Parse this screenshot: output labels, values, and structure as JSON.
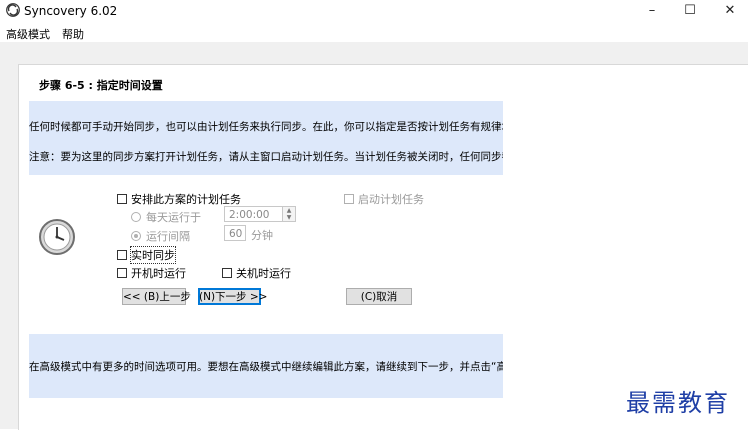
{
  "window": {
    "title": "Syncovery 6.02",
    "minimize": "–",
    "maximize": "☐",
    "close": "✕"
  },
  "menu": [
    "高级模式",
    "帮助"
  ],
  "step_title": "步骤 6-5 : 指定时间设置",
  "info_top": [
    "任何时候都可手动开始同步，也可以由计划任务来执行同步。在此，你可以指定是否按计划任务有规律地执行同步。",
    "注意：要为这里的同步方案打开计划任务，请从主窗口启动计划任务。当计划任务被关闭时，任何同步都不会自动执行。"
  ],
  "options": {
    "schedule_label": "安排此方案的计划任务",
    "start_scheduler_label": "启动计划任务",
    "daily_label": "每天运行于",
    "daily_time": "2:00:00",
    "interval_label": "运行间隔",
    "interval_value": "60",
    "interval_unit": "分钟",
    "realtime_label": "实时同步",
    "on_startup_label": "开机时运行",
    "on_shutdown_label": "关机时运行"
  },
  "buttons": {
    "back": "<< (B)上一步",
    "next": "(N)下一步 >>",
    "cancel": "(C)取消"
  },
  "info_bottom": "在高级模式中有更多的时间选项可用。要想在高级模式中继续编辑此方案，请继续到下一步，并点击“高级设置”按钮。",
  "watermark": "最需教育",
  "colors": {
    "info_bg": "#dde8fa",
    "page_bg": "#f0f0f0",
    "focus": "#0078d7"
  }
}
